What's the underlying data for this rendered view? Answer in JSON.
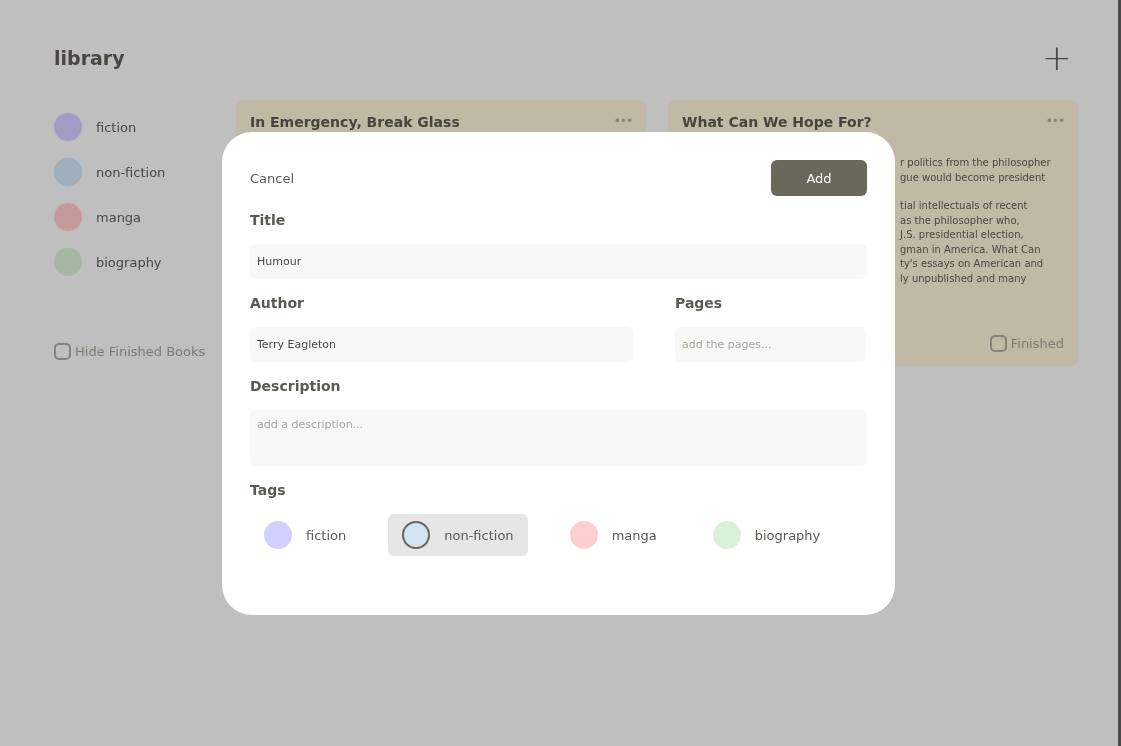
{
  "header": {
    "title": "library",
    "add_icon": "+"
  },
  "sidebar": {
    "tags": [
      {
        "label": "fiction",
        "color": "#a09cc4"
      },
      {
        "label": "non-fiction",
        "color": "#9fafbd"
      },
      {
        "label": "manga",
        "color": "#c59a9a"
      },
      {
        "label": "biography",
        "color": "#a6b8a3"
      }
    ],
    "hide_finished": {
      "label": "Hide Finished Books",
      "checked": false
    }
  },
  "books": [
    {
      "title": "In Emergency, Break Glass",
      "menu": "•••"
    },
    {
      "title": "What Can We Hope For?",
      "menu": "•••",
      "description_paragraphs": [
        [
          "r politics from the philosopher",
          "gue would become president"
        ],
        [
          "tial intellectuals of recent",
          "as the philosopher who,",
          "J.S. presidential election,",
          "gman in America. What Can",
          "ty's essays on American and",
          "ly unpublished and many"
        ]
      ],
      "finished": {
        "label": "Finished",
        "checked": false
      }
    }
  ],
  "dialog": {
    "cancel": "Cancel",
    "submit": "Add",
    "title": {
      "label": "Title",
      "value": "Humour"
    },
    "author": {
      "label": "Author",
      "value": "Terry Eagleton"
    },
    "pages": {
      "label": "Pages",
      "placeholder": "add the pages..."
    },
    "description": {
      "label": "Description",
      "placeholder": "add a description..."
    },
    "tags_label": "Tags",
    "tags": [
      {
        "label": "fiction",
        "color": "#d4d0fe",
        "selected": false
      },
      {
        "label": "non-fiction",
        "color": "#d4e4f4",
        "selected": true
      },
      {
        "label": "manga",
        "color": "#ffcfcf",
        "selected": false
      },
      {
        "label": "biography",
        "color": "#d9f1d7",
        "selected": false
      }
    ]
  }
}
